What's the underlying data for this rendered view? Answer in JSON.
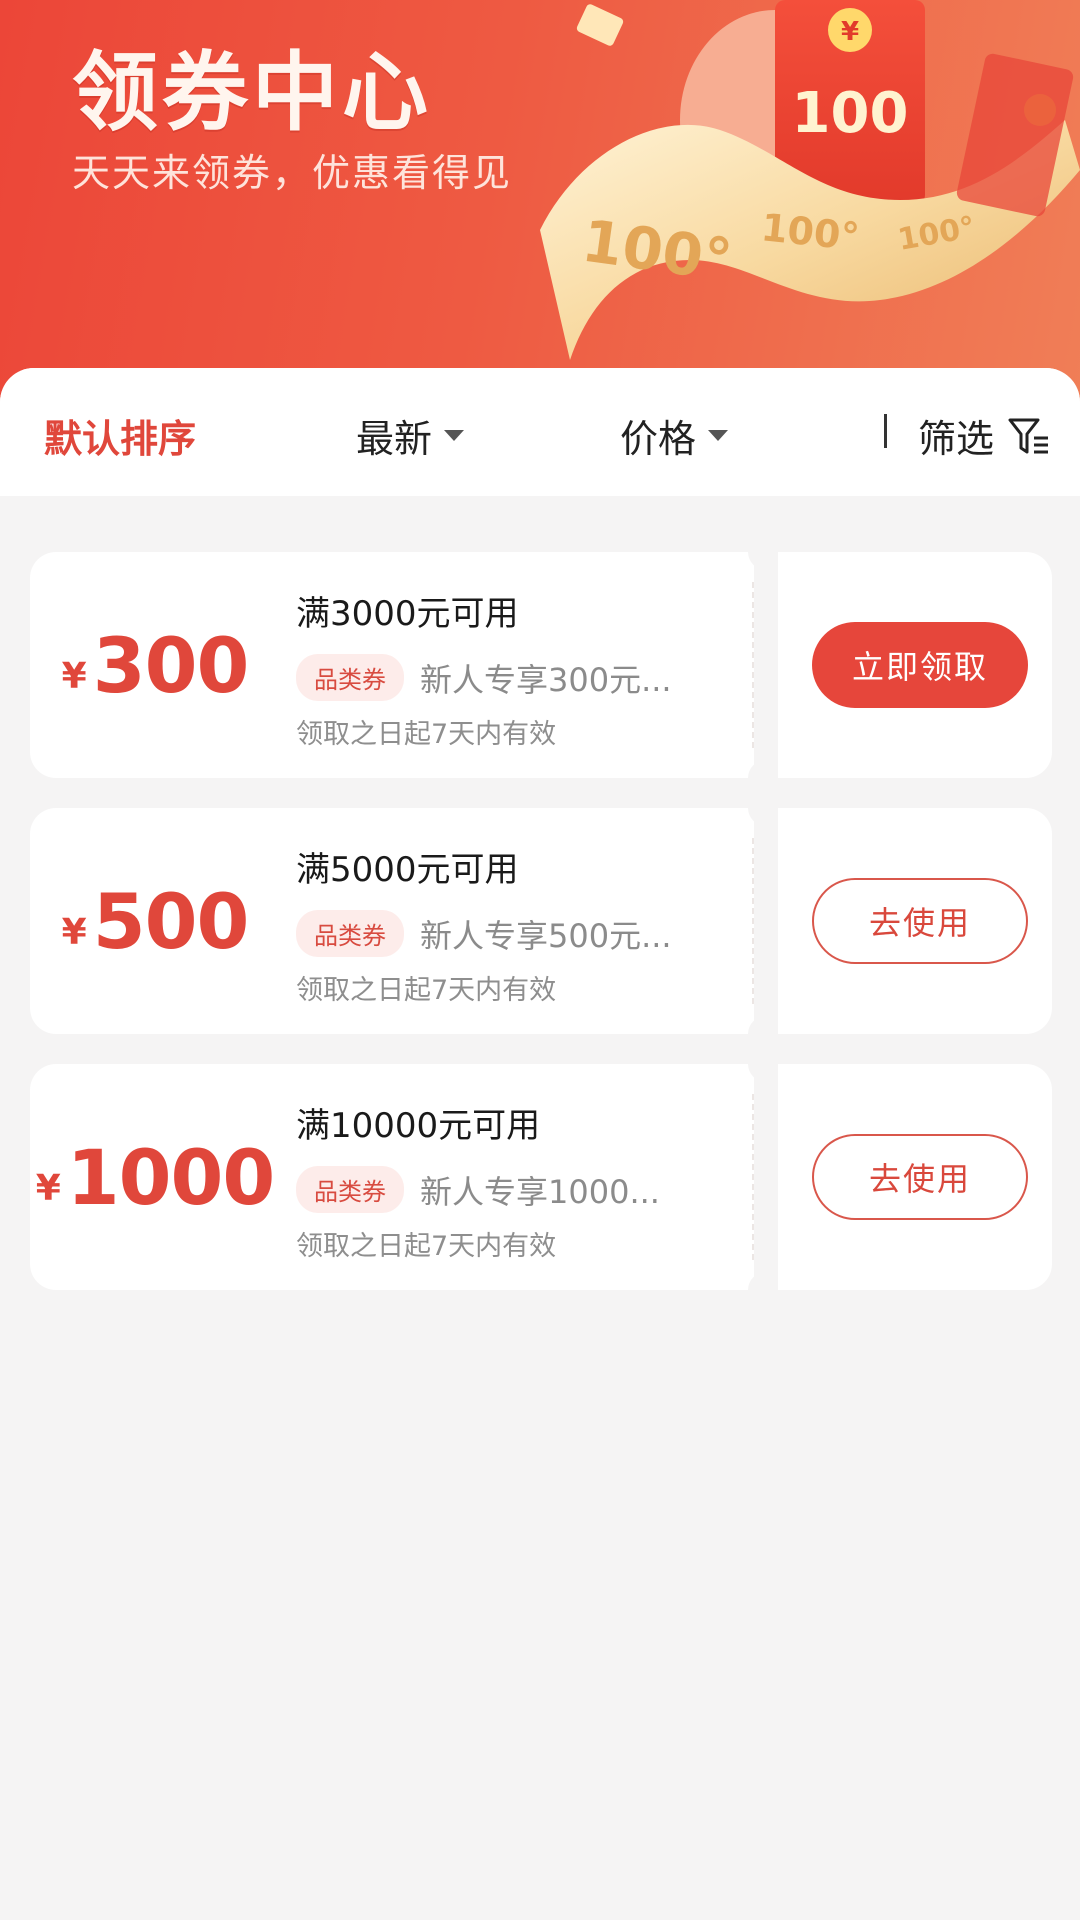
{
  "banner": {
    "title": "领券中心",
    "subtitle": "天天来领券，优惠看得见",
    "art_values": [
      "100",
      "100°",
      "100°",
      "100°"
    ]
  },
  "sortbar": {
    "items": [
      {
        "label": "默认排序",
        "active": true
      },
      {
        "label": "最新"
      },
      {
        "label": "价格"
      }
    ],
    "filter_label": "筛选"
  },
  "coupons": [
    {
      "currency": "¥",
      "amount": "300",
      "title": "满3000元可用",
      "tag": "品类券",
      "desc": "新人专享300元...",
      "validity": "领取之日起7天内有效",
      "button": "立即领取",
      "button_style": "primary"
    },
    {
      "currency": "¥",
      "amount": "500",
      "title": "满5000元可用",
      "tag": "品类券",
      "desc": "新人专享500元...",
      "validity": "领取之日起7天内有效",
      "button": "去使用",
      "button_style": "outline"
    },
    {
      "currency": "¥",
      "amount": "1000",
      "title": "满10000元可用",
      "tag": "品类券",
      "desc": "新人专享1000...",
      "validity": "领取之日起7天内有效",
      "button": "去使用",
      "button_style": "outline"
    }
  ],
  "colors": {
    "accent": "#e0473b",
    "banner_start": "#ec4638",
    "banner_end": "#f07e57",
    "tag_bg": "#fdecea"
  }
}
